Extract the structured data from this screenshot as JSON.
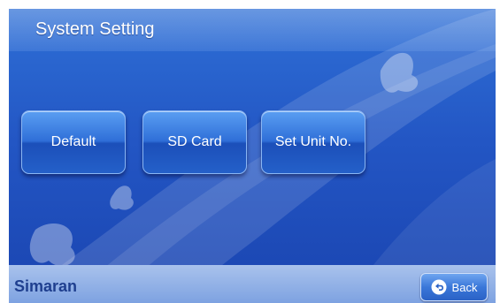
{
  "header": {
    "title": "System Setting"
  },
  "buttons": {
    "default_label": "Default",
    "sd_card_label": "SD Card",
    "set_unit_label": "Set Unit No."
  },
  "footer": {
    "brand": "Simaran",
    "back_label": "Back"
  },
  "colors": {
    "background": "#2356c4",
    "button": "#2f6fd8",
    "footer": "#7ea2e1",
    "brand_text": "#1f3f8f"
  },
  "icons": {
    "back": "return-arrow-icon"
  }
}
